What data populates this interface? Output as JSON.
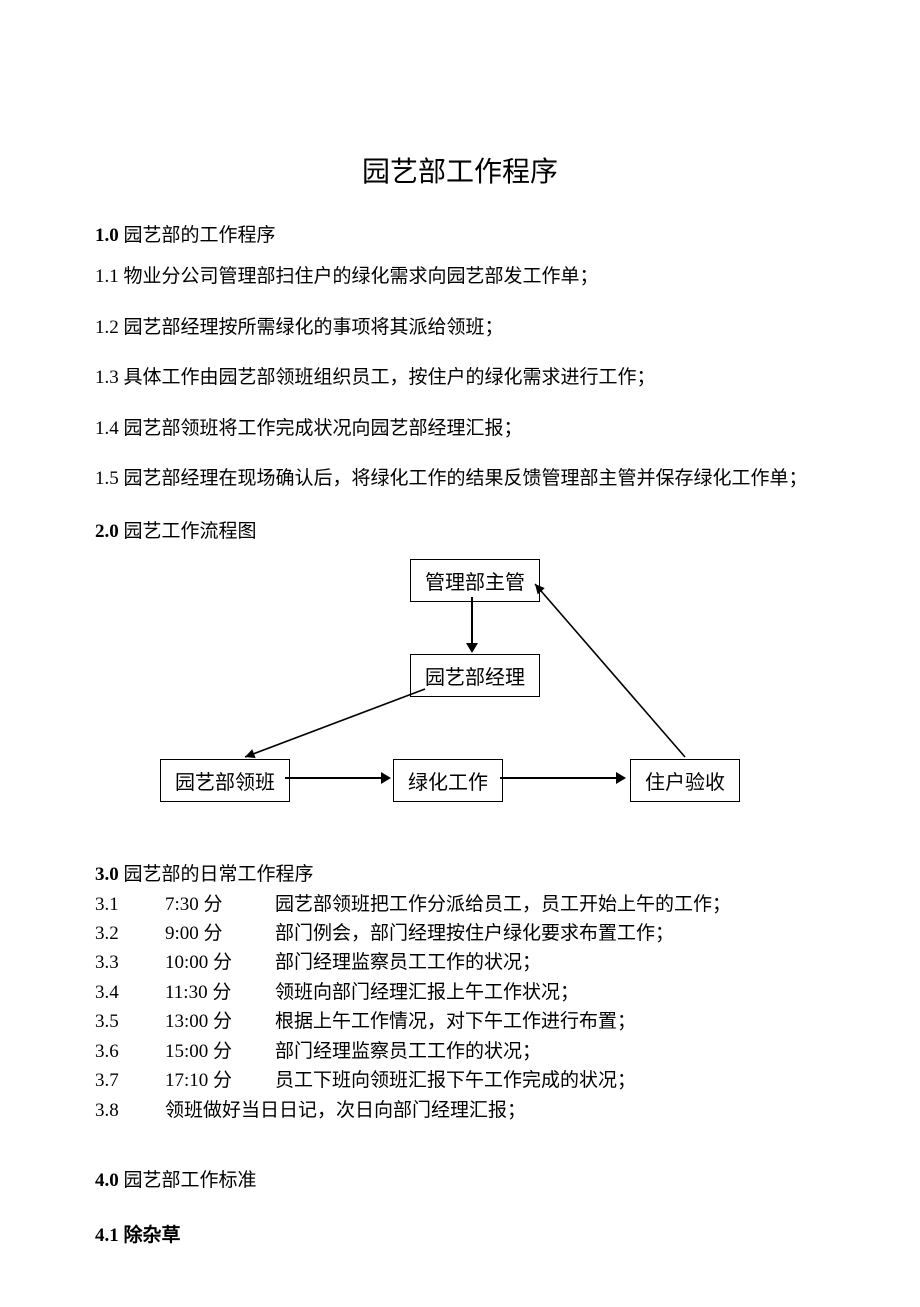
{
  "title": "园艺部工作程序",
  "s1": {
    "head_num": "1.0",
    "head_txt": " 园艺部的工作程序",
    "items": [
      {
        "num": "1.1",
        "txt": "  物业分公司管理部扫住户的绿化需求向园艺部发工作单；"
      },
      {
        "num": "1.2",
        "txt": "  园艺部经理按所需绿化的事项将其派给领班；"
      },
      {
        "num": "1.3",
        "txt": "  具体工作由园艺部领班组织员工，按住户的绿化需求进行工作；"
      },
      {
        "num": "1.4",
        "txt": "  园艺部领班将工作完成状况向园艺部经理汇报；"
      },
      {
        "num": "1.5",
        "txt": " 园艺部经理在现场确认后，将绿化工作的结果反馈管理部主管并保存绿化工作单；"
      }
    ]
  },
  "s2": {
    "head_num": "2.0",
    "head_txt": " 园艺工作流程图",
    "nodes": {
      "top": "管理部主管",
      "mid": "园艺部经理",
      "b1": "园艺部领班",
      "b2": "绿化工作",
      "b3": "住户验收"
    }
  },
  "s3": {
    "head_num": "3.0",
    "head_txt": " 园艺部的日常工作程序",
    "rows": [
      {
        "n": "3.1",
        "t": "7:30",
        "u": "分",
        "d": "园艺部领班把工作分派给员工，员工开始上午的工作；"
      },
      {
        "n": "3.2",
        "t": "9:00",
        "u": "分",
        "d": "部门例会，部门经理按住户绿化要求布置工作；"
      },
      {
        "n": "3.3",
        "t": "10:00",
        "u": "分",
        "d": "部门经理监察员工工作的状况；"
      },
      {
        "n": "3.4",
        "t": "11:30",
        "u": "分",
        "d": "领班向部门经理汇报上午工作状况；"
      },
      {
        "n": "3.5",
        "t": "13:00",
        "u": "分",
        "d": "根据上午工作情况，对下午工作进行布置；"
      },
      {
        "n": "3.6",
        "t": "15:00",
        "u": "分",
        "d": "部门经理监察员工工作的状况；"
      },
      {
        "n": "3.7",
        "t": "17:10",
        "u": "分",
        "d": "员工下班向领班汇报下午工作完成的状况；"
      }
    ],
    "last": {
      "n": "3.8",
      "d": "领班做好当日日记，次日向部门经理汇报；"
    }
  },
  "s4": {
    "head_num": "4.0",
    "head_txt": " 园艺部工作标准",
    "sub_num": "4.1",
    "sub_txt": "  除杂草"
  }
}
